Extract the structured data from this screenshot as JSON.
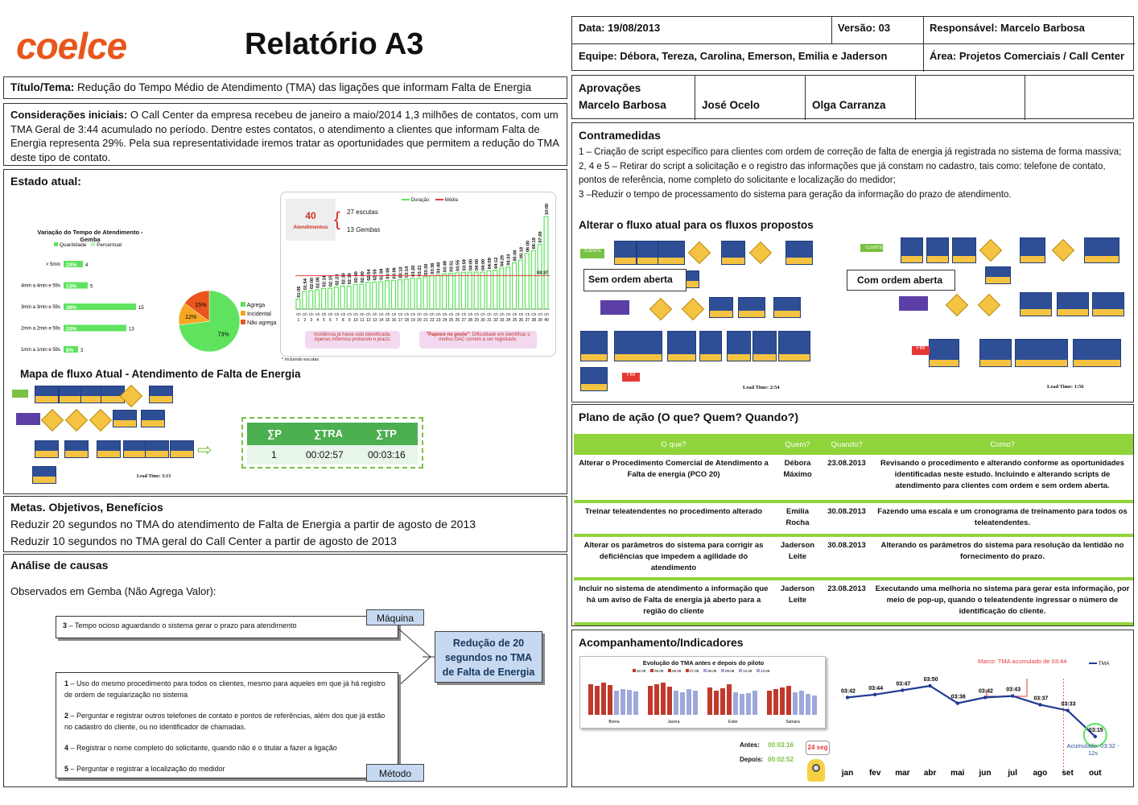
{
  "header": {
    "logo": "coelce",
    "title": "Relatório A3",
    "date": "Data: 19/08/2013",
    "version": "Versão: 03",
    "responsible": "Responsável: Marcelo Barbosa",
    "team": "Equipe: Débora, Tereza, Carolina, Emerson, Emilia e Jaderson",
    "area": "Área: Projetos Comerciais / Call Center"
  },
  "title_section": {
    "label": "Título/Tema:",
    "text": "Redução do Tempo Médio de Atendimento (TMA) das ligações que informam Falta de Energia"
  },
  "considerations": {
    "label": "Considerações iniciais:",
    "text": "O Call Center da empresa recebeu de janeiro a maio/2014 1,3 milhões de contatos, com um TMA Geral de 3:44 acumulado no período. Dentre estes contatos, o atendimento a clientes que informam Falta de Energia representa 29%.  Pela sua representatividade iremos tratar as oportunidades que permitem a redução do TMA deste tipo de contato."
  },
  "current_state": {
    "label": "Estado atual:",
    "variation_title": "Variação do Tempo de Atendimento - Gemba",
    "variation_legend": [
      "Quantidade",
      "Percentual"
    ],
    "pie_legend": [
      "Agrega",
      "Incidental",
      "Não agrega"
    ],
    "pie_labels": [
      "73%",
      "12%",
      "15%"
    ],
    "sample_count": "40",
    "sample_label": "Atendimentos",
    "listens": "27 escutas",
    "gembas_num": "13",
    "gembas_word": "Gembas",
    "duration_legend": [
      "Duração",
      "Média"
    ],
    "avg_label": "03:37",
    "note1": "Incidência já havia sido identificada. Apenas informou protocolo e prazo.",
    "note2_bold": "\"Papoco no poste\"",
    "note2": ": Dificuldade em identificar o motivo GAC correto a ser registrado.",
    "footnote": "* Incluindo escutas",
    "flow_title": "Mapa de fluxo Atual  - Atendimento de Falta de Energia",
    "lead_time": "Lead Time: 3:13",
    "sum_headers": [
      "∑P",
      "∑TRA",
      "∑TP"
    ],
    "sum_values": [
      "1",
      "00:02:57",
      "00:03:16"
    ]
  },
  "chart_data": [
    {
      "type": "bar",
      "title": "Variação do Tempo de Atendimento - Gemba",
      "orientation": "horizontal",
      "categories": [
        "> 5min",
        "4min a 4min e 59s",
        "3min a 3min e 59s",
        "2min a 2min e 59s",
        "1min a 1min e 59s"
      ],
      "series": [
        {
          "name": "Quantidade",
          "values": [
            4,
            5,
            15,
            13,
            3
          ]
        },
        {
          "name": "Percentual",
          "values": [
            "10%",
            "13%",
            "38%",
            "33%",
            "8%"
          ]
        }
      ]
    },
    {
      "type": "pie",
      "categories": [
        "Agrega",
        "Incidental",
        "Não agrega"
      ],
      "values": [
        73,
        12,
        15
      ],
      "colors": [
        "#5fe35f",
        "#f5a623",
        "#e8561c"
      ]
    },
    {
      "type": "bar",
      "series": [
        {
          "name": "Duração"
        },
        {
          "name": "Média",
          "values": [
            "03:37"
          ]
        }
      ],
      "categories": [
        "1",
        "2",
        "3",
        "4",
        "5",
        "6",
        "7",
        "8",
        "9",
        "10",
        "11",
        "12",
        "13",
        "14",
        "15",
        "16",
        "17",
        "18",
        "19",
        "20",
        "21",
        "22",
        "23",
        "24",
        "25",
        "26",
        "27",
        "28",
        "29",
        "30",
        "31",
        "32",
        "33",
        "34",
        "35",
        "36",
        "37",
        "38",
        "39",
        "40"
      ],
      "value_labels": [
        "01:05",
        "01:54",
        "02:00",
        "02:05",
        "02:14",
        "02:15",
        "02:23",
        "02:30",
        "02:30",
        "02:40",
        "02:40",
        "02:54",
        "02:55",
        "02:59",
        "03:05",
        "03:06",
        "03:10",
        "03:14",
        "03:20",
        "03:21",
        "03:30",
        "03:36",
        "03:40",
        "03:49",
        "03:51",
        "03:55",
        "03:59",
        "04:00",
        "04:00",
        "04:00",
        "04:09",
        "04:12",
        "04:26",
        "04:33",
        "05:00",
        "05:18",
        "06:00",
        "06:19",
        "07:00",
        "10:00"
      ],
      "values_min": [
        1.08,
        1.9,
        2.0,
        2.08,
        2.23,
        2.25,
        2.38,
        2.5,
        2.5,
        2.67,
        2.67,
        2.9,
        2.92,
        2.98,
        3.08,
        3.1,
        3.17,
        3.23,
        3.33,
        3.35,
        3.5,
        3.6,
        3.67,
        3.82,
        3.85,
        3.92,
        3.98,
        4.0,
        4.0,
        4.0,
        4.15,
        4.2,
        4.43,
        4.55,
        5.0,
        5.3,
        6.0,
        6.32,
        7.0,
        10.0
      ],
      "mean": "03:37"
    },
    {
      "type": "bar",
      "title": "Evolução do TMA antes e depois do piloto",
      "series_names": [
        "02.08",
        "05.08",
        "06.08",
        "07.08",
        "08.08",
        "09.08",
        "12.08",
        "13.08"
      ],
      "categories": [
        "Brena",
        "Jacera",
        "Ester",
        "Samara"
      ]
    },
    {
      "type": "line",
      "series": [
        {
          "name": "TMA",
          "values": [
            "03:42",
            "03:44",
            "03:47",
            "03:50",
            "03:38",
            "03:42",
            "03:43",
            "03:37",
            "03:33",
            "03:15"
          ]
        }
      ],
      "categories": [
        "jan",
        "fev",
        "mar",
        "abr",
        "mai",
        "jun",
        "jul",
        "ago",
        "set",
        "out"
      ],
      "values_sec": [
        222,
        224,
        227,
        230,
        218,
        222,
        223,
        217,
        213,
        195
      ],
      "annotation_mean": "Marco: TMA acumulado de 03:44",
      "annotation_acc": "Acumulado: 03:32 - 12s"
    }
  ],
  "goals": {
    "label": "Metas. Objetivos, Benefícios",
    "items": [
      "Reduzir 20 segundos no TMA do atendimento de Falta de Energia a partir de agosto de 2013",
      "Reduzir 10 segundos no TMA geral do Call Center a partir de agosto de 2013"
    ]
  },
  "analysis": {
    "label": "Análise de causas",
    "subtitle": "Observados em Gemba (Não Agrega Valor):",
    "machine_num": "3",
    "machine_text": " – Tempo ocioso aguardando o sistema gerar o prazo para atendimento",
    "machine_tag": "Máquina",
    "method_tag": "Método",
    "effect": "Redução de 20 segundos no TMA de Falta de Energia",
    "method_items": [
      {
        "num": "1",
        "text": " – Uso do mesmo procedimento para todos os clientes, mesmo para aqueles em que já há registro de ordem de regularização no sistema"
      },
      {
        "num": "2",
        "text": " – Perguntar e registrar outros telefones de contato e pontos de referências, além dos que já estão no cadastro do cliente, ou no identificador de chamadas."
      },
      {
        "num": "4",
        "text": " – Registrar o nome completo do solicitante, quando não é o titular a fazer a ligação"
      },
      {
        "num": "5",
        "text": " – Perguntar e registrar a localização do medidor"
      }
    ]
  },
  "approvals": {
    "label": "Aprovações",
    "names": [
      "Marcelo Barbosa",
      "José Ocelo",
      "Olga Carranza"
    ]
  },
  "countermeasures": {
    "label": "Contramedidas",
    "items": [
      "1 – Criação de script específico para clientes com ordem de correção de falta de energia já registrada no sistema de forma massiva;",
      "2, 4 e 5 – Retirar do script a solicitação e o registro das informações que já constam no cadastro, tais como: telefone de contato, pontos de referência, nome completo do solicitante e localização do medidor;",
      "3 –Reduzir o tempo de processamento do sistema para geração da informação do prazo de atendimento."
    ],
    "flows_label": "Alterar o fluxo atual para os fluxos propostos",
    "flow_left": "Sem ordem aberta",
    "flow_right": "Com ordem aberta",
    "lead_left": "Lead Time: 2:54",
    "lead_right": "Lead Time: 1:56",
    "fim": "FIM",
    "client": "CLIENTE"
  },
  "action_plan": {
    "label": "Plano de ação (O que? Quem? Quando?)",
    "headers": [
      "O que?",
      "Quem?",
      "Quando?",
      "Como?"
    ],
    "rows": [
      [
        "Alterar o Procedimento Comercial de Atendimento a Falta de energia (PCO 20)",
        "Débora Máximo",
        "23.08.2013",
        "Revisando o procedimento e alterando conforme as oportunidades identificadas neste estudo. Incluindo e alterando scripts de atendimento para clientes com ordem e sem ordem aberta."
      ],
      [
        "Treinar teleatendentes no procedimento alterado",
        "Emilia Rocha",
        "30.08.2013",
        "Fazendo uma escala e um cronograma de treinamento para todos os teleatendentes."
      ],
      [
        "Alterar os parâmetros do sistema para corrigir as deficiências que impedem a agilidade do atendimento",
        "Jaderson Leite",
        "30.08.2013",
        "Alterando os parâmetros do sistema para resolução da lentidão no fornecimento do prazo."
      ],
      [
        "Incluir no sistema de atendimento a informação que há um aviso de Falta de energia já aberto para a região do cliente",
        "Jaderson Leite",
        "23.08.2013",
        "Executando uma melhoria no sistema para gerar esta informação, por meio de pop-up, quando o teleatendente ingressar o número de identificação do cliente."
      ]
    ]
  },
  "tracking": {
    "label": "Acompanhamento/Indicadores",
    "before_label": "Antes:",
    "before_value": "00:03:16",
    "after_label": "Depois:",
    "after_value": "00:02:52",
    "diff": "24 seg",
    "tma_legend": "TMA"
  }
}
